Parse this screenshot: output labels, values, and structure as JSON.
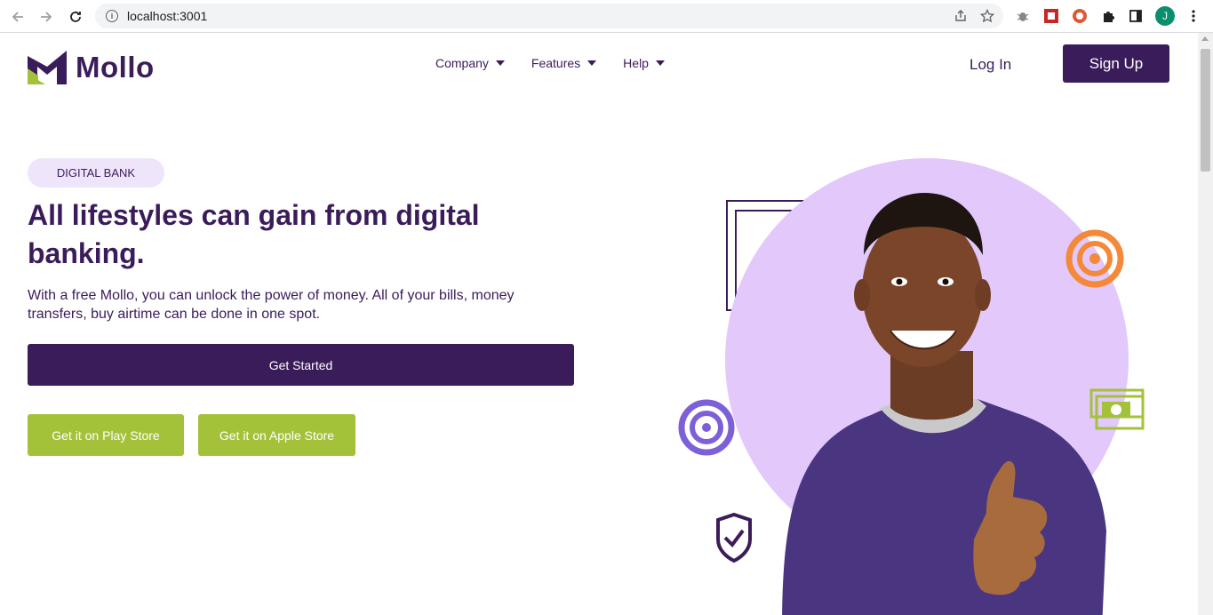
{
  "browser": {
    "url": "localhost:3001",
    "profile_initial": "J"
  },
  "site": {
    "brand": "Mollo",
    "nav": [
      {
        "label": "Company"
      },
      {
        "label": "Features"
      },
      {
        "label": "Help"
      }
    ],
    "login_label": "Log In",
    "signup_label": "Sign Up"
  },
  "hero": {
    "badge": "DIGITAL BANK",
    "title": "All lifestyles can gain from digital banking.",
    "subtitle": "With a free Mollo, you can unlock the power of money. All of your bills, money transfers, buy airtime can be done in one spot.",
    "cta_label": "Get Started",
    "play_store_label": "Get it on Play Store",
    "apple_store_label": "Get it on Apple Store"
  },
  "colors": {
    "brand_purple": "#3b1c5a",
    "accent_green": "#a3c23a",
    "circle_lilac": "#e2c8fb",
    "swirl_orange": "#f5893a",
    "swirl_purple": "#7d60d8"
  },
  "icons": [
    "back-arrow-icon",
    "forward-arrow-icon",
    "reload-icon",
    "info-icon",
    "share-icon",
    "star-icon",
    "bug-icon",
    "puzzle-icon",
    "sidebar-icon",
    "menu-dots-icon",
    "orange-swirl-icon",
    "purple-swirl-icon",
    "banknote-icon",
    "shield-check-icon"
  ]
}
